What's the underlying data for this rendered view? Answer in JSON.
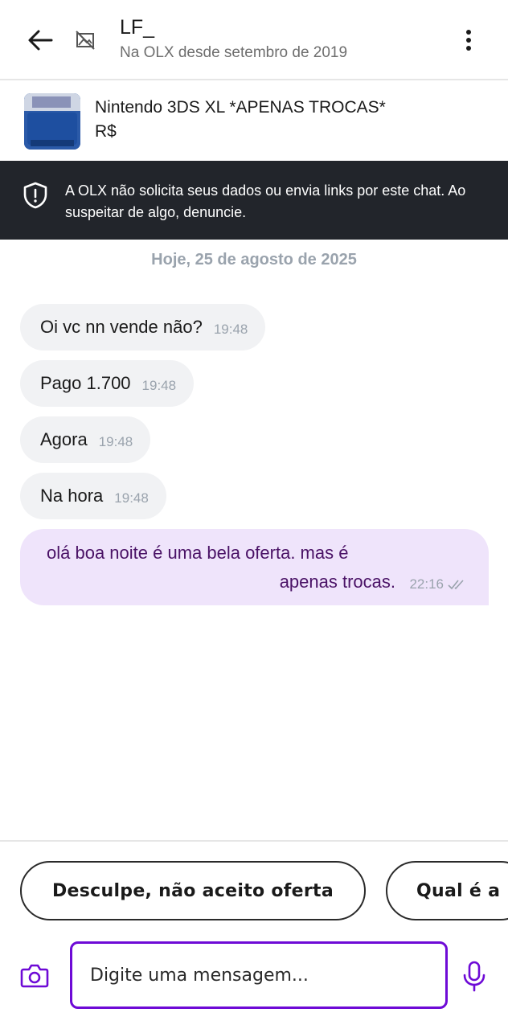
{
  "header": {
    "back_icon": "arrow-left-icon",
    "avatar_icon": "broken-image-icon",
    "contact_name": "LF_",
    "contact_subtitle": "Na OLX desde setembro de 2019",
    "more_icon": "more-vertical-icon"
  },
  "product": {
    "title": "Nintendo 3DS XL *APENAS TROCAS*",
    "price": "R$"
  },
  "warning": {
    "icon": "shield-icon",
    "text": "A OLX não solicita seus dados ou envia links por este chat. Ao suspeitar de algo, denuncie."
  },
  "chat": {
    "date_separator": "Hoje, 25 de agosto de 2025",
    "incoming": [
      {
        "text": "Oi vc nn vende não?",
        "time": "19:48"
      },
      {
        "text": "Pago 1.700",
        "time": "19:48"
      },
      {
        "text": "Agora",
        "time": "19:48"
      },
      {
        "text": "Na hora",
        "time": "19:48"
      }
    ],
    "outgoing": {
      "line1": "olá boa noite é uma bela oferta. mas é",
      "line2": "apenas trocas.",
      "time": "22:16",
      "status_icon": "double-check-icon"
    }
  },
  "quick_replies": [
    "Desculpe, não aceito oferta",
    "Qual é a"
  ],
  "composer": {
    "camera_icon": "camera-icon",
    "placeholder": "Digite uma mensagem...",
    "mic_icon": "microphone-icon"
  },
  "colors": {
    "accent": "#6e0ad6",
    "warning_bg": "#22252b",
    "incoming_bubble": "#f1f2f4",
    "outgoing_bubble": "#efe4fb",
    "outgoing_text": "#4a1266"
  }
}
